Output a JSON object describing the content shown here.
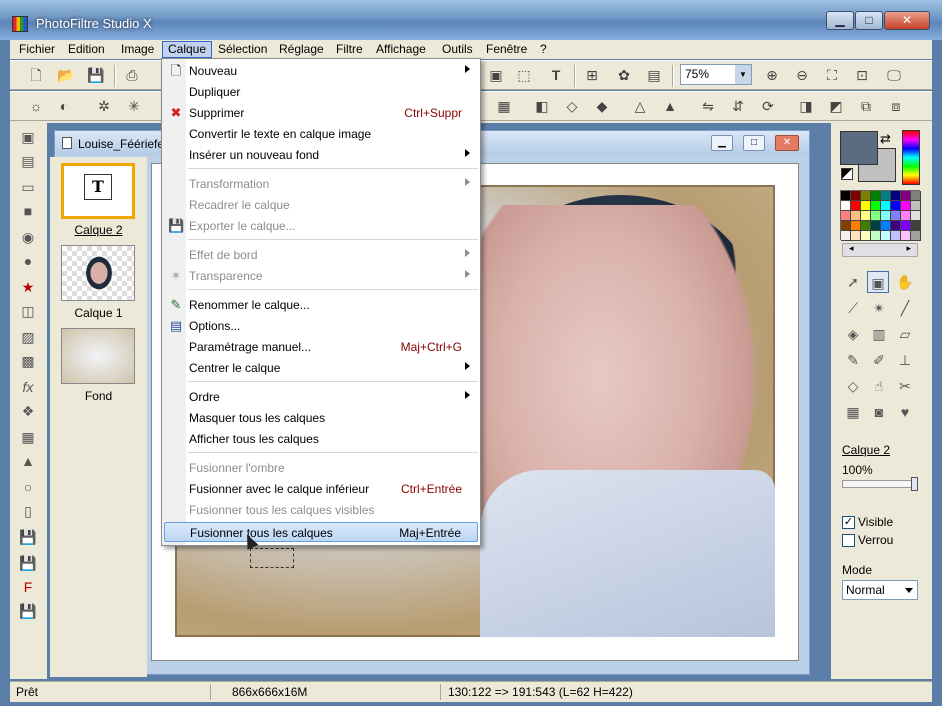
{
  "window": {
    "title": "PhotoFiltre Studio X",
    "min": "▁",
    "max": "□",
    "close": "✕"
  },
  "menubar": [
    "Fichier",
    "Edition",
    "Image",
    "Calque",
    "Sélection",
    "Réglage",
    "Filtre",
    "Affichage",
    "Outils",
    "Fenêtre",
    "?"
  ],
  "toolbar": {
    "zoom_value": "75%"
  },
  "document": {
    "title": "Louise_Féériefes",
    "min": "▁",
    "max": "□",
    "close": "✕"
  },
  "layers": [
    {
      "label": "Calque 2",
      "icon": "T"
    },
    {
      "label": "Calque 1"
    },
    {
      "label": "Fond"
    }
  ],
  "calque_menu": {
    "items": [
      {
        "label": "Nouveau",
        "submenu": true
      },
      {
        "label": "Dupliquer"
      },
      {
        "label": "Supprimer",
        "shortcut": "Ctrl+Suppr",
        "icon": "delete-icon"
      },
      {
        "label": "Convertir le texte en calque image"
      },
      {
        "label": "Insérer un nouveau fond",
        "submenu": true
      },
      {
        "label": "Transformation",
        "disabled": true,
        "submenu": true
      },
      {
        "label": "Recadrer le calque",
        "disabled": true
      },
      {
        "label": "Exporter le calque...",
        "disabled": true,
        "icon": "save-icon"
      },
      {
        "label": "Effet de bord",
        "disabled": true,
        "submenu": true
      },
      {
        "label": "Transparence",
        "disabled": true,
        "submenu": true,
        "icon": "transparency-icon"
      },
      {
        "label": "Renommer le calque...",
        "icon": "rename-icon"
      },
      {
        "label": "Options...",
        "icon": "options-icon"
      },
      {
        "label": "Paramétrage manuel...",
        "shortcut": "Maj+Ctrl+G"
      },
      {
        "label": "Centrer le calque",
        "submenu": true
      },
      {
        "label": "Ordre",
        "submenu": true
      },
      {
        "label": "Masquer tous les calques"
      },
      {
        "label": "Afficher tous les calques"
      },
      {
        "label": "Fusionner l'ombre",
        "disabled": true
      },
      {
        "label": "Fusionner avec le calque inférieur",
        "shortcut": "Ctrl+Entrée"
      },
      {
        "label": "Fusionner tous les calques visibles",
        "disabled": true
      },
      {
        "label": "Fusionner tous les calques",
        "shortcut": "Maj+Entrée",
        "hover": true
      }
    ]
  },
  "right_panel": {
    "layer_name": "Calque 2",
    "opacity": "100%",
    "opacity_fraction": 1.0,
    "visible_label": "Visible",
    "visible_checked": true,
    "verrou_label": "Verrou",
    "verrou_checked": false,
    "mode_label": "Mode",
    "mode_value": "Normal",
    "fg_color": "#5b6b80",
    "bg_color": "#c0c0c0"
  },
  "statusbar": {
    "state": "Prêt",
    "size": "866x666x16M",
    "coords": "130:122 => 191:543 (L=62  H=422)"
  }
}
